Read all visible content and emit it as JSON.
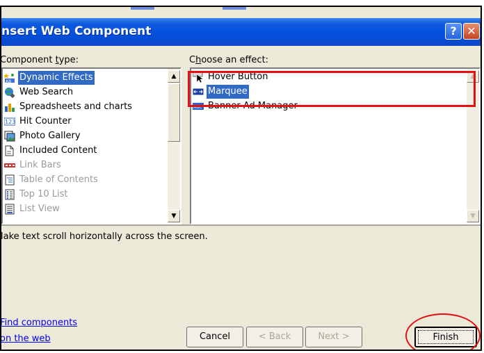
{
  "window": {
    "title": "nsert Web Component",
    "help_glyph": "?",
    "close_glyph": "✕"
  },
  "component_type": {
    "label_pre": "Component ",
    "label_key": "t",
    "label_post": "ype:",
    "items": [
      {
        "label": "Dynamic Effects",
        "icon": "dynamic-effects-icon",
        "selected": true,
        "disabled": false
      },
      {
        "label": "Web Search",
        "icon": "web-search-icon",
        "selected": false,
        "disabled": false
      },
      {
        "label": "Spreadsheets and charts",
        "icon": "spreadsheets-charts-icon",
        "selected": false,
        "disabled": false
      },
      {
        "label": "Hit Counter",
        "icon": "hit-counter-icon",
        "selected": false,
        "disabled": false
      },
      {
        "label": "Photo Gallery",
        "icon": "photo-gallery-icon",
        "selected": false,
        "disabled": false
      },
      {
        "label": "Included Content",
        "icon": "included-content-icon",
        "selected": false,
        "disabled": false
      },
      {
        "label": "Link Bars",
        "icon": "link-bars-icon",
        "selected": false,
        "disabled": true
      },
      {
        "label": "Table of Contents",
        "icon": "table-of-contents-icon",
        "selected": false,
        "disabled": true
      },
      {
        "label": "Top 10 List",
        "icon": "top-10-list-icon",
        "selected": false,
        "disabled": true
      },
      {
        "label": "List View",
        "icon": "list-view-icon",
        "selected": false,
        "disabled": true
      }
    ]
  },
  "effect": {
    "label_pre": "C",
    "label_key": "h",
    "label_post": "oose an effect:",
    "items": [
      {
        "label": "Hover Button",
        "icon": "hover-button-icon",
        "selected": false
      },
      {
        "label": "Marquee",
        "icon": "marquee-icon",
        "selected": true
      },
      {
        "label": "Banner Ad Manager",
        "icon": "banner-ad-manager-icon",
        "selected": false
      }
    ]
  },
  "description": "lake text scroll horizontally across the screen.",
  "links": {
    "line1": "Find components",
    "line2": "on the web"
  },
  "buttons": {
    "cancel": "Cancel",
    "back": "< Back",
    "next": "Next >",
    "finish": "Finish"
  },
  "colors": {
    "selection": "#316ac5",
    "annotation": "#e21010",
    "titlebar": "#0350db"
  }
}
